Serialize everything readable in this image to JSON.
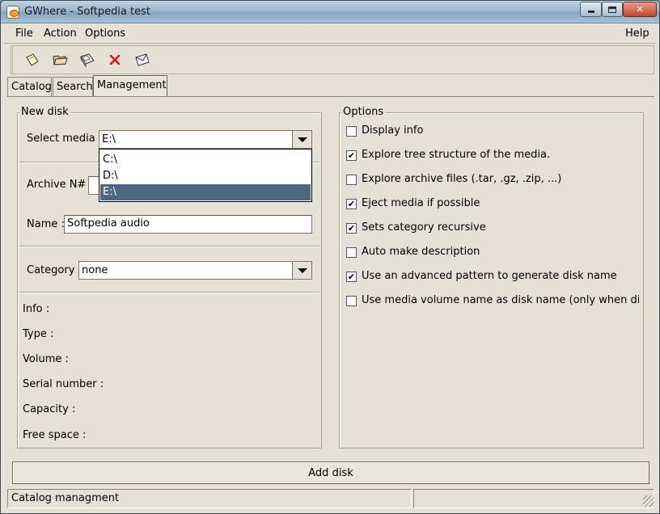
{
  "window": {
    "title": "GWhere - Softpedia test"
  },
  "menu": {
    "file": "File",
    "action": "Action",
    "options": "Options",
    "help": "Help"
  },
  "toolbar": [
    {
      "icon": "new-catalog-icon"
    },
    {
      "icon": "open-folder-icon"
    },
    {
      "icon": "save-disk-icon"
    },
    {
      "icon": "delete-x-icon"
    },
    {
      "icon": "envelope-icon"
    }
  ],
  "tabs": {
    "catalog": "Catalog",
    "search": "Search",
    "management": "Management"
  },
  "new_disk": {
    "legend": "New disk",
    "select_media_label": "Select media :",
    "select_media_value": "E:\\",
    "media_options": [
      "C:\\",
      "D:\\",
      "E:\\"
    ],
    "archive_label": "Archive N# :",
    "name_label": "Name :",
    "name_value": "Softpedia audio",
    "category_label": "Category :",
    "category_value": "none",
    "info_label": "Info :",
    "type_label": "Type :",
    "volume_label": "Volume :",
    "serial_label": "Serial number :",
    "capacity_label": "Capacity :",
    "free_space_label": "Free space :"
  },
  "options": {
    "legend": "Options",
    "items": [
      {
        "label": "Display info",
        "checked": false
      },
      {
        "label": "Explore tree structure of the media.",
        "checked": true
      },
      {
        "label": "Explore archive files (.tar, .gz, .zip, ...)",
        "checked": false
      },
      {
        "label": "Eject media if possible",
        "checked": true
      },
      {
        "label": "Sets category recursive",
        "checked": true
      },
      {
        "label": "Auto make description",
        "checked": false
      },
      {
        "label": "Use an advanced pattern to generate disk name",
        "checked": true
      },
      {
        "label": "Use media volume name as disk name (only when disk nar",
        "checked": false
      }
    ]
  },
  "add_disk_label": "Add disk",
  "status": {
    "text": "Catalog managment"
  }
}
